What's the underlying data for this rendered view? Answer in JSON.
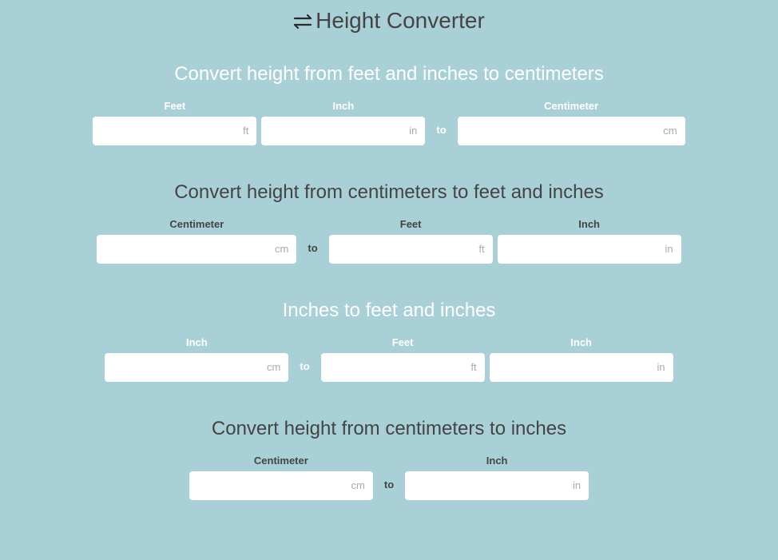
{
  "header": {
    "title": "Height Converter"
  },
  "to_label": "to",
  "units": {
    "ft": "ft",
    "in": "in",
    "cm": "cm"
  },
  "sections": {
    "ftinch_to_cm": {
      "title": "Convert height from feet and inches to centimeters",
      "labels": {
        "feet": "Feet",
        "inch": "Inch",
        "cm": "Centimeter"
      },
      "values": {
        "feet": "",
        "inch": "",
        "cm": ""
      }
    },
    "cm_to_ftinch": {
      "title": "Convert height from centimeters to feet and inches",
      "labels": {
        "cm": "Centimeter",
        "feet": "Feet",
        "inch": "Inch"
      },
      "values": {
        "cm": "",
        "feet": "",
        "inch": ""
      }
    },
    "inch_to_ftinch": {
      "title": "Inches to feet and inches",
      "labels": {
        "inch_in": "Inch",
        "feet": "Feet",
        "inch_out": "Inch"
      },
      "values": {
        "inch_in": "",
        "feet": "",
        "inch_out": ""
      }
    },
    "cm_to_inch": {
      "title": "Convert height from centimeters to inches",
      "labels": {
        "cm": "Centimeter",
        "inch": "Inch"
      },
      "values": {
        "cm": "",
        "inch": ""
      }
    }
  }
}
